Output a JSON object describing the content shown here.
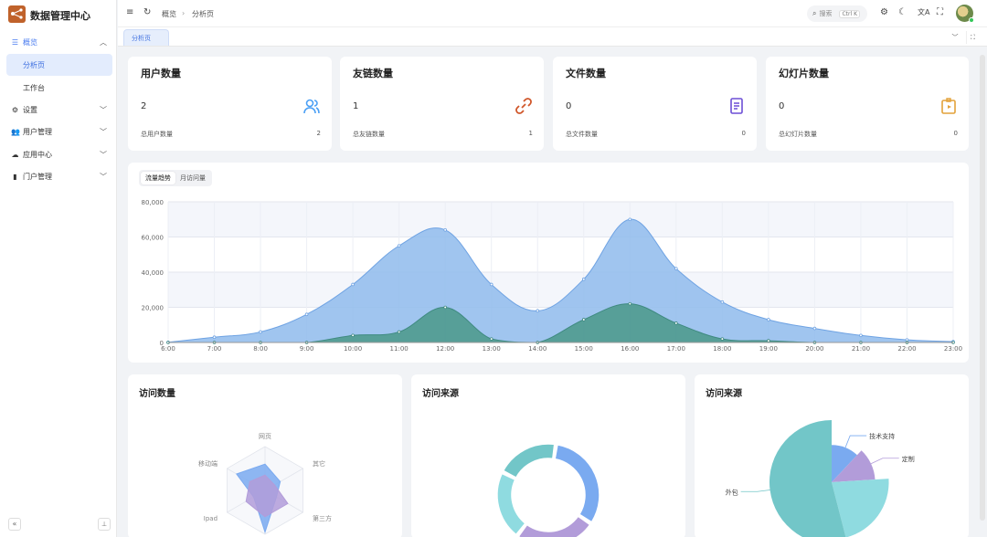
{
  "app": {
    "title": "数据管理中心"
  },
  "sidebar": {
    "items": [
      {
        "label": "概览",
        "icon": "menu-icon",
        "expanded": true,
        "children": [
          {
            "label": "分析页",
            "active": true
          },
          {
            "label": "工作台"
          }
        ]
      },
      {
        "label": "设置",
        "icon": "gears-icon"
      },
      {
        "label": "用户管理",
        "icon": "users-icon"
      },
      {
        "label": "应用中心",
        "icon": "cloud-icon"
      },
      {
        "label": "门户管理",
        "icon": "file-icon"
      }
    ]
  },
  "header": {
    "breadcrumb": [
      "概览",
      "分析页"
    ],
    "search_placeholder": "搜索",
    "search_shortcut": "Ctrl K"
  },
  "tabs": [
    {
      "label": "分析页",
      "active": true
    }
  ],
  "stats": [
    {
      "title": "用户数量",
      "value": "2",
      "footer_label": "总用户数量",
      "footer_value": "2",
      "icon": "users-icon",
      "color": "#4a9ff5"
    },
    {
      "title": "友链数量",
      "value": "1",
      "footer_label": "总友链数量",
      "footer_value": "1",
      "icon": "link-icon",
      "color": "#d0572b"
    },
    {
      "title": "文件数量",
      "value": "0",
      "footer_label": "总文件数量",
      "footer_value": "0",
      "icon": "document-icon",
      "color": "#6d4fd6"
    },
    {
      "title": "幻灯片数量",
      "value": "0",
      "footer_label": "总幻灯片数量",
      "footer_value": "0",
      "icon": "slides-icon",
      "color": "#e3a23a"
    }
  ],
  "traffic": {
    "tabs": [
      "流量趋势",
      "月访问量"
    ],
    "active_tab": 0
  },
  "chart_data": [
    {
      "type": "area",
      "x": [
        "6:00",
        "7:00",
        "8:00",
        "9:00",
        "10:00",
        "11:00",
        "12:00",
        "13:00",
        "14:00",
        "15:00",
        "16:00",
        "17:00",
        "18:00",
        "19:00",
        "20:00",
        "21:00",
        "22:00",
        "23:00"
      ],
      "series": [
        {
          "values": [
            100,
            3000,
            6000,
            16000,
            33000,
            55000,
            64000,
            33000,
            18000,
            36000,
            70000,
            42000,
            23000,
            13000,
            8000,
            4000,
            1500,
            500
          ],
          "color": "#8fbbec"
        },
        {
          "values": [
            0,
            0,
            0,
            0,
            4000,
            6000,
            20000,
            2000,
            0,
            13000,
            22000,
            11000,
            2000,
            1000,
            0,
            0,
            0,
            0
          ],
          "color": "#4f9a8e"
        }
      ],
      "yticks": [
        0,
        20000,
        40000,
        60000,
        80000
      ],
      "ytick_labels": [
        "0",
        "20,000",
        "40,000",
        "60,000",
        "80,000"
      ],
      "ylim": [
        0,
        80000
      ],
      "grid": true
    },
    {
      "type": "radar",
      "title": "访问数量",
      "indicators": [
        "网页",
        "其它",
        "第三方",
        "客户端",
        "Ipad",
        "移动端"
      ],
      "series": [
        {
          "values": [
            60,
            40,
            30,
            95,
            30,
            75
          ],
          "color": "#7aaaf0"
        },
        {
          "values": [
            35,
            25,
            60,
            60,
            50,
            40
          ],
          "color": "#b29cd9"
        }
      ],
      "max": 100
    },
    {
      "type": "pie",
      "title": "访问来源",
      "donut": true,
      "slices": [
        {
          "value": 32,
          "color": "#7aaaf0"
        },
        {
          "value": 26,
          "color": "#b29cd9"
        },
        {
          "value": 22,
          "color": "#8fdbe0"
        },
        {
          "value": 20,
          "color": "#72c6c8"
        }
      ]
    },
    {
      "type": "pie",
      "title": "访问来源",
      "rose": true,
      "slices": [
        {
          "label": "技术支持",
          "value": 12,
          "radius": 0.6,
          "color": "#7aaaf0"
        },
        {
          "label": "定制",
          "value": 12,
          "radius": 0.7,
          "color": "#b29cd9"
        },
        {
          "label": "",
          "value": 22,
          "radius": 0.92,
          "color": "#8fdbe0"
        },
        {
          "label": "外包",
          "value": 54,
          "radius": 1.0,
          "color": "#72c6c8"
        }
      ]
    }
  ]
}
